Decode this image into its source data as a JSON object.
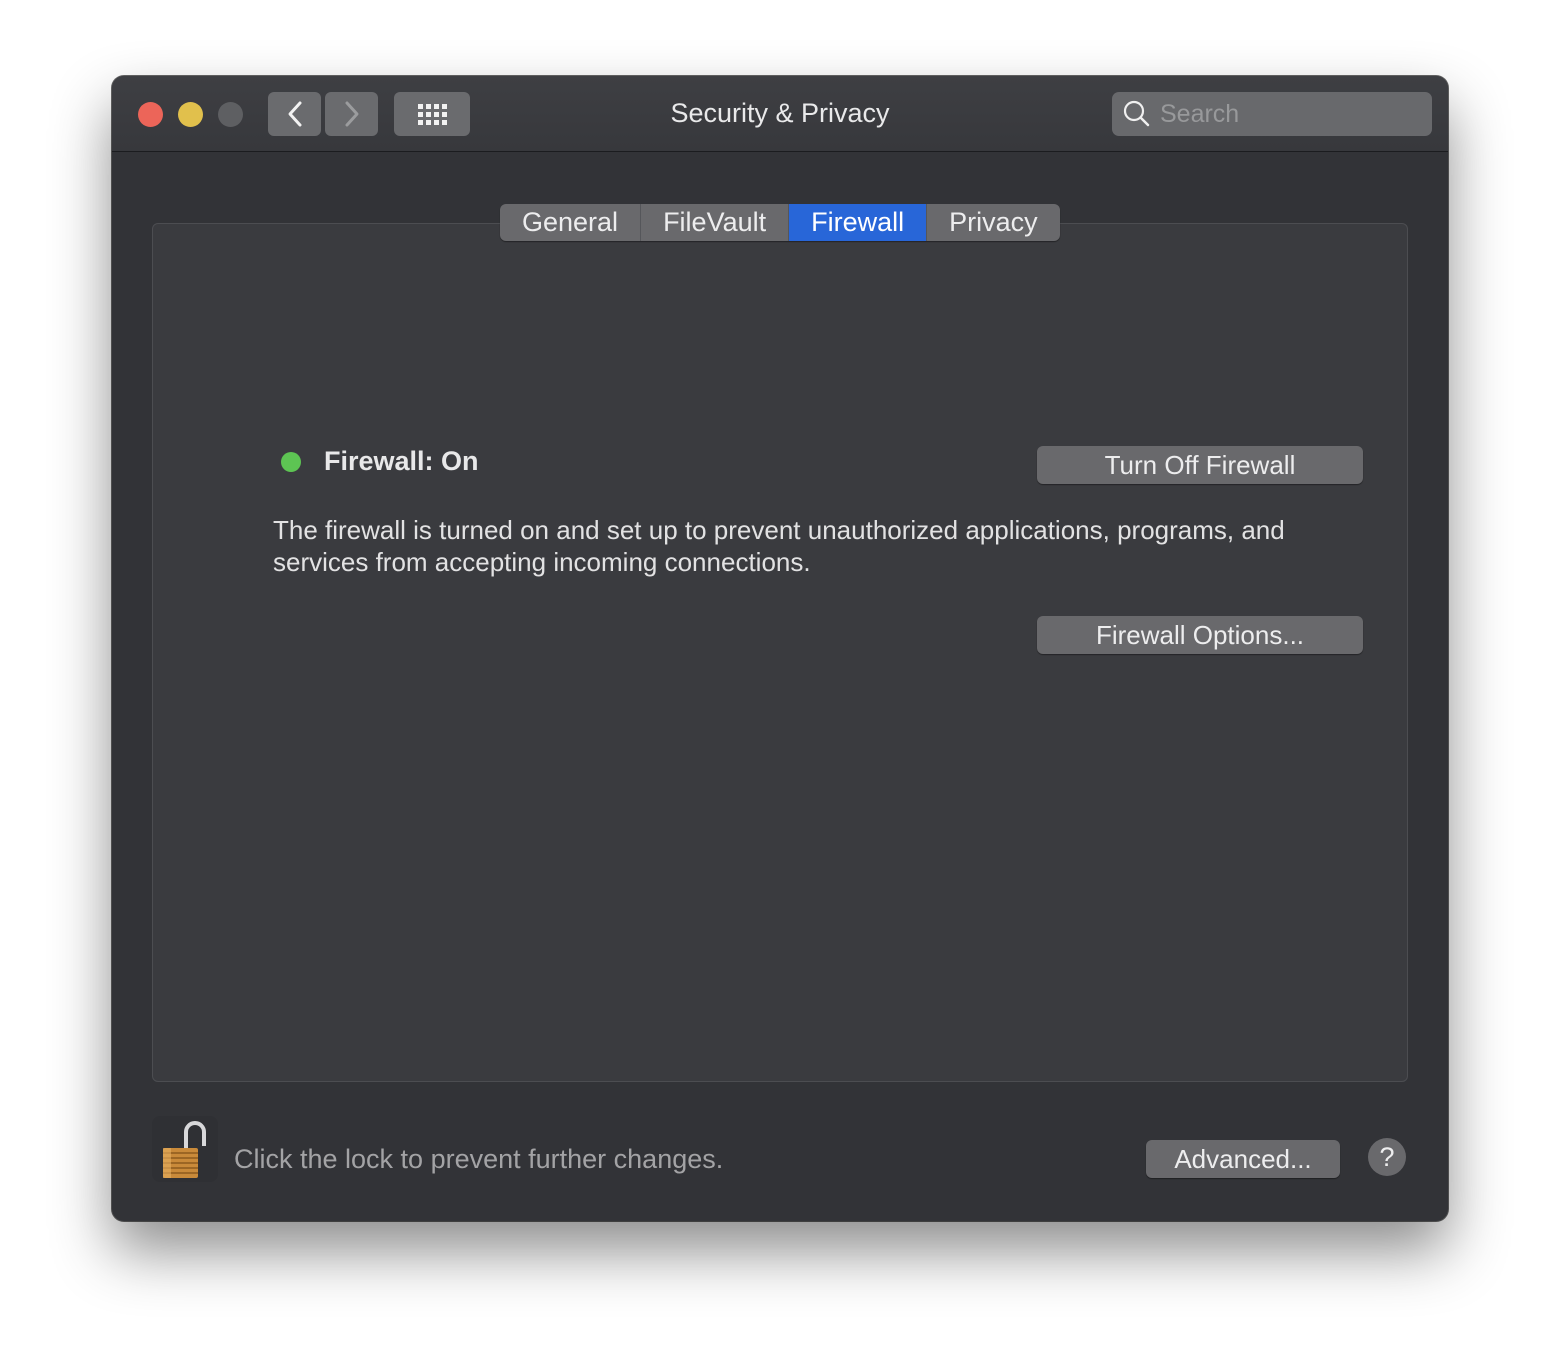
{
  "window": {
    "title": "Security & Privacy",
    "traffic_lights": [
      "close",
      "minimize",
      "zoom"
    ],
    "nav": {
      "back_icon": "chevron-left-icon",
      "forward_icon": "chevron-right-icon",
      "grid_icon": "show-all-grid-icon"
    },
    "search": {
      "placeholder": "Search",
      "value": ""
    }
  },
  "tabs": [
    {
      "label": "General",
      "active": false
    },
    {
      "label": "FileVault",
      "active": false
    },
    {
      "label": "Firewall",
      "active": true
    },
    {
      "label": "Privacy",
      "active": false
    }
  ],
  "firewall": {
    "status_label": "Firewall: On",
    "status_color": "#5dc453",
    "turn_off_label": "Turn Off Firewall",
    "description": "The firewall is turned on and set up to prevent unauthorized applications, programs, and services from accepting incoming connections.",
    "options_label": "Firewall Options..."
  },
  "footer": {
    "lock_text": "Click the lock to prevent further changes.",
    "advanced_label": "Advanced...",
    "help_label": "?"
  },
  "colors": {
    "accent": "#2866d8",
    "window_bg": "#323337"
  }
}
